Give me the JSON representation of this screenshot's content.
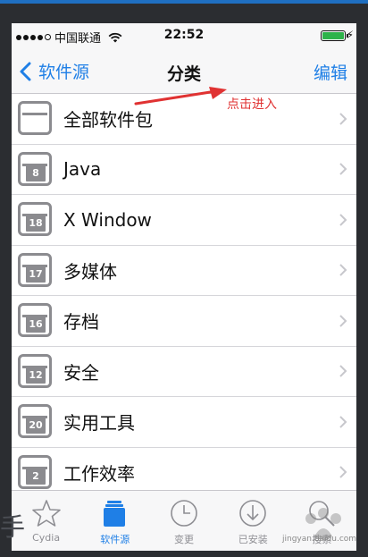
{
  "status_bar": {
    "carrier": "中国联通",
    "time": "22:52",
    "signal_icon": "signal-dots-icon",
    "wifi_icon": "wifi-icon",
    "battery_icon": "battery-icon",
    "charging_icon": "charging-bolt-icon",
    "battery_color": "#2db34a"
  },
  "nav": {
    "back_label": "软件源",
    "title": "分类",
    "edit_label": "编辑",
    "accent_color": "#1f7fe6"
  },
  "rows": [
    {
      "label": "全部软件包",
      "badge": ""
    },
    {
      "label": "Java",
      "badge": "8"
    },
    {
      "label": "X Window",
      "badge": "18"
    },
    {
      "label": "多媒体",
      "badge": "17"
    },
    {
      "label": "存档",
      "badge": "16"
    },
    {
      "label": "安全",
      "badge": "12"
    },
    {
      "label": "实用工具",
      "badge": "20"
    },
    {
      "label": "工作效率",
      "badge": "2"
    }
  ],
  "annotation": {
    "text": "点击进入",
    "color": "#e03232"
  },
  "tabs": [
    {
      "label": "Cydia",
      "icon": "star-icon"
    },
    {
      "label": "软件源",
      "icon": "sources-icon",
      "active": true
    },
    {
      "label": "变更",
      "icon": "clock-icon"
    },
    {
      "label": "已安装",
      "icon": "download-icon"
    },
    {
      "label": "搜索",
      "icon": "search-icon"
    }
  ],
  "watermark": {
    "text": "jingyan.baidu.com"
  }
}
